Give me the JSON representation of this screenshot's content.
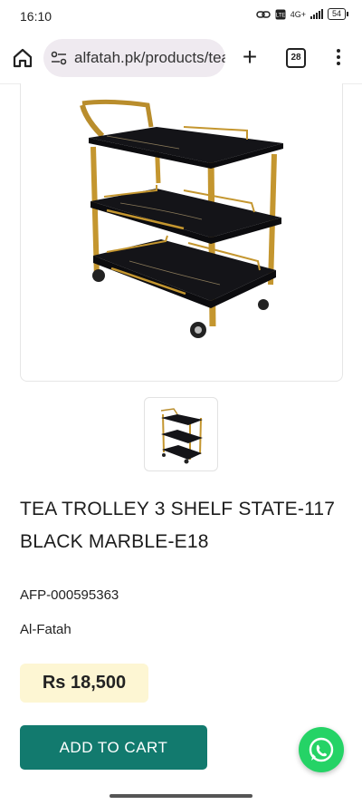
{
  "status_bar": {
    "time": "16:10",
    "network": "4G+",
    "battery": "54"
  },
  "browser": {
    "url": "alfatah.pk/products/tea-trolley",
    "tab_count": "28"
  },
  "product": {
    "title": "TEA TROLLEY 3 SHELF STATE-117 BLACK MARBLE-E18",
    "sku": "AFP-000595363",
    "brand": "Al-Fatah",
    "price": "Rs 18,500",
    "add_to_cart_label": "ADD TO CART"
  },
  "icons": {
    "home": "home-icon",
    "site_info": "site-info-icon",
    "new_tab": "plus-icon",
    "tabs": "tabs-icon",
    "menu": "more-vert-icon",
    "whatsapp": "whatsapp-icon"
  },
  "colors": {
    "accent": "#127a6e",
    "price_bg": "#fdf6d3",
    "whatsapp": "#25d366"
  }
}
